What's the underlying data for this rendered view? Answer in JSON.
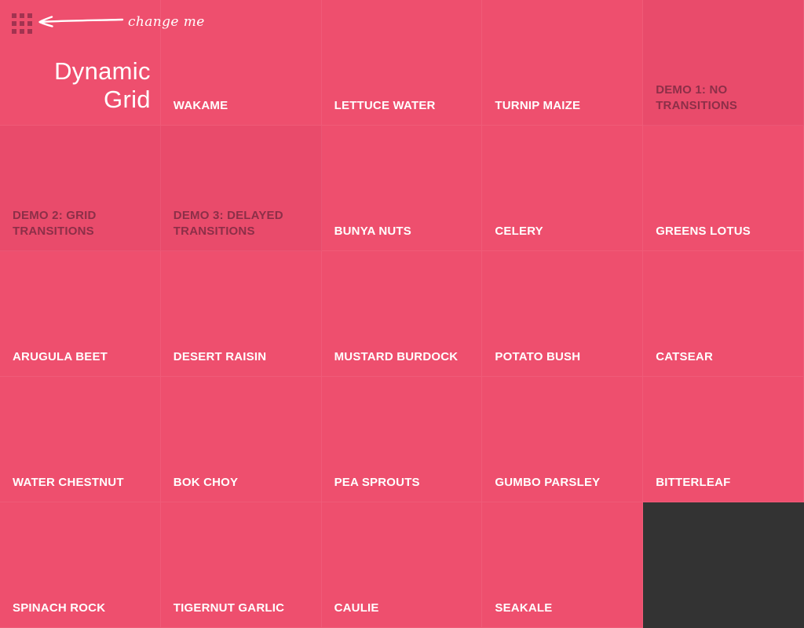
{
  "page": {
    "background_color": "#333333",
    "tile_color": "#ee4f6e",
    "demo_tile_color": "#e94b6b",
    "demo_text_color": "#8c2f48",
    "icon_color": "#a23350"
  },
  "header": {
    "title_line1": "Dynamic",
    "title_line2": "Grid",
    "grid_icon_name": "grid-menu-icon",
    "annotation_text": "change me",
    "annotation_arrow": "arrow-left-icon"
  },
  "grid": {
    "columns": 5,
    "rows": 5,
    "cells": [
      {
        "id": "brand",
        "label": "",
        "kind": "brand"
      },
      {
        "id": "wakame",
        "label": "WAKAME",
        "kind": "item"
      },
      {
        "id": "lettuce-water",
        "label": "LETTUCE WATER",
        "kind": "item"
      },
      {
        "id": "turnip-maize",
        "label": "TURNIP MAIZE",
        "kind": "item"
      },
      {
        "id": "demo-1",
        "label": "DEMO 1: NO TRANSITIONS",
        "kind": "demo"
      },
      {
        "id": "demo-2",
        "label": "DEMO 2: GRID TRANSITIONS",
        "kind": "demo"
      },
      {
        "id": "demo-3",
        "label": "DEMO 3: DELAYED TRANSITIONS",
        "kind": "demo"
      },
      {
        "id": "bunya-nuts",
        "label": "BUNYA NUTS",
        "kind": "item"
      },
      {
        "id": "celery",
        "label": "CELERY",
        "kind": "item"
      },
      {
        "id": "greens-lotus",
        "label": "GREENS LOTUS",
        "kind": "item"
      },
      {
        "id": "arugula-beet",
        "label": "ARUGULA BEET",
        "kind": "item"
      },
      {
        "id": "desert-raisin",
        "label": "DESERT RAISIN",
        "kind": "item"
      },
      {
        "id": "mustard-burdock",
        "label": "MUSTARD BURDOCK",
        "kind": "item"
      },
      {
        "id": "potato-bush",
        "label": "POTATO BUSH",
        "kind": "item"
      },
      {
        "id": "catsear",
        "label": "CATSEAR",
        "kind": "item"
      },
      {
        "id": "water-chestnut",
        "label": "WATER CHESTNUT",
        "kind": "item"
      },
      {
        "id": "bok-choy",
        "label": "BOK CHOY",
        "kind": "item"
      },
      {
        "id": "pea-sprouts",
        "label": "PEA SPROUTS",
        "kind": "item"
      },
      {
        "id": "gumbo-parsley",
        "label": "GUMBO PARSLEY",
        "kind": "item"
      },
      {
        "id": "bitterleaf",
        "label": "BITTERLEAF",
        "kind": "item"
      },
      {
        "id": "spinach-rock",
        "label": "SPINACH ROCK",
        "kind": "item"
      },
      {
        "id": "tigernut-garlic",
        "label": "TIGERNUT GARLIC",
        "kind": "item"
      },
      {
        "id": "caulie",
        "label": "CAULIE",
        "kind": "item"
      },
      {
        "id": "seakale",
        "label": "SEAKALE",
        "kind": "item"
      },
      {
        "id": "empty-slot",
        "label": "",
        "kind": "empty"
      }
    ]
  }
}
